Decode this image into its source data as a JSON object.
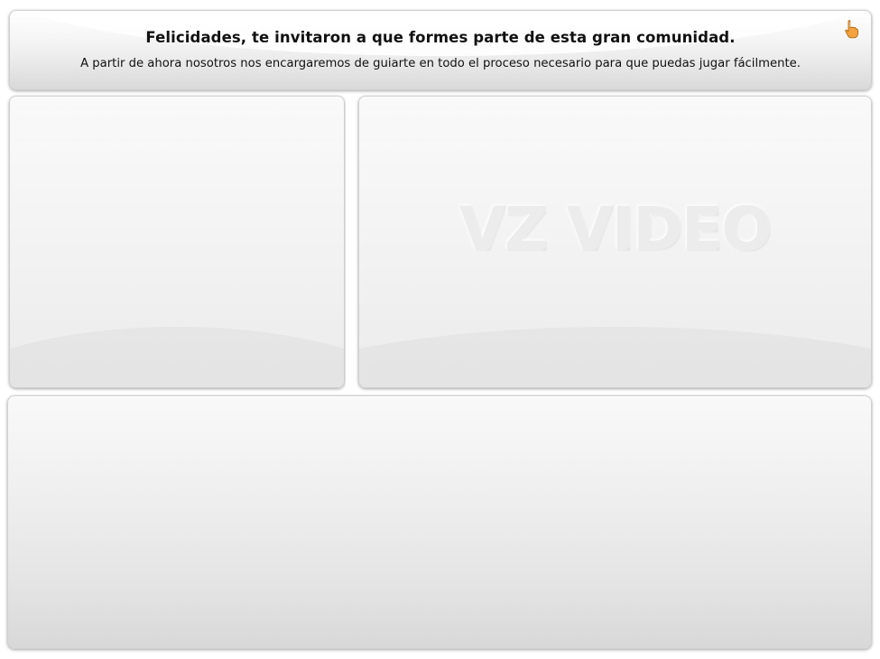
{
  "header": {
    "title": "Felicidades, te invitaron a que formes parte de esta gran comunidad.",
    "subtitle": "A partir de ahora nosotros nos encargaremos de guiarte en todo el proceso necesario para que puedas jugar fácilmente.",
    "icon": "pointing-hand-icon"
  },
  "video": {
    "watermark": "VZ VIDEO"
  },
  "colors": {
    "panel_bg": "#f2f2f2",
    "hand_icon": "#f4a340",
    "text": "#111111"
  }
}
